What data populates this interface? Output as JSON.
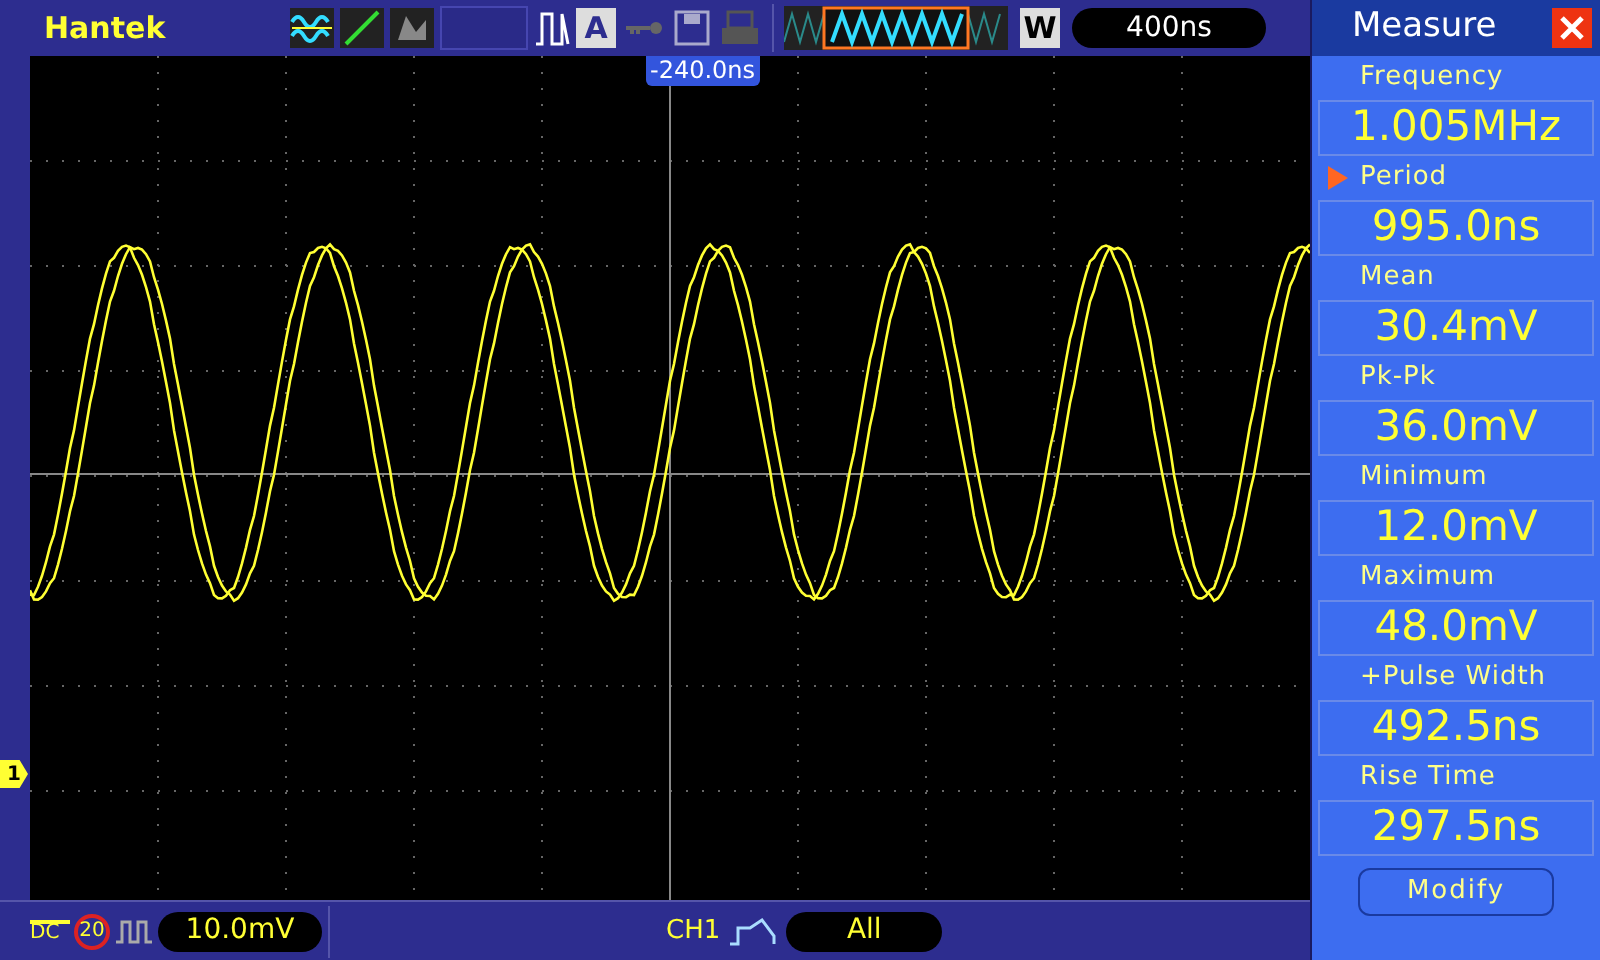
{
  "top_bar": {
    "brand": "Hantek",
    "auto_label": "A",
    "window_label": "W",
    "timebase": "400ns"
  },
  "screen": {
    "trigger_position": "-240.0ns",
    "channel_marker": "1"
  },
  "bottom_bar": {
    "coupling": "DC",
    "bandwidth_limit": "20",
    "volts_per_div": "10.0mV",
    "trigger_source": "CH1",
    "trigger_mode": "All"
  },
  "measure": {
    "title": "Measure",
    "items": [
      {
        "label": "Frequency",
        "value": "1.005MHz",
        "selected": false
      },
      {
        "label": "Period",
        "value": "995.0ns",
        "selected": true
      },
      {
        "label": "Mean",
        "value": "30.4mV",
        "selected": false
      },
      {
        "label": "Pk-Pk",
        "value": "36.0mV",
        "selected": false
      },
      {
        "label": "Minimum",
        "value": "12.0mV",
        "selected": false
      },
      {
        "label": "Maximum",
        "value": "48.0mV",
        "selected": false
      },
      {
        "label": "+Pulse Width",
        "value": "492.5ns",
        "selected": false
      },
      {
        "label": "Rise Time",
        "value": "297.5ns",
        "selected": false
      }
    ],
    "button": "Modify"
  }
}
